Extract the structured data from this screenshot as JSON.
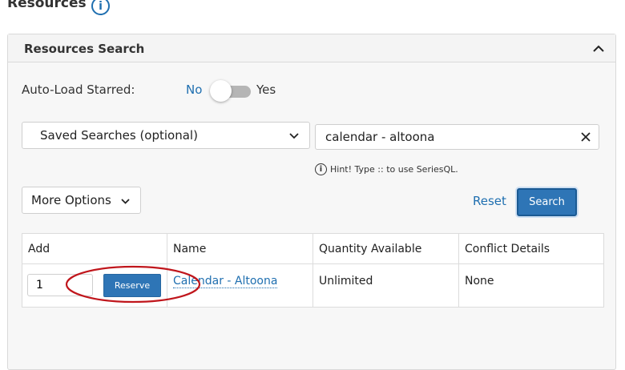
{
  "page": {
    "title": "Resources",
    "info_icon": "info-circle-icon",
    "info_glyph": "i"
  },
  "panel": {
    "title": "Resources Search",
    "collapse_icon": "chevron-up-icon"
  },
  "auto_load": {
    "label": "Auto-Load Starred:",
    "off_label": "No",
    "on_label": "Yes",
    "enabled": false
  },
  "saved_searches": {
    "label": "Saved Searches (optional)",
    "icon": "chevron-down-icon"
  },
  "search": {
    "value": "calendar - altoona",
    "clear_icon": "close-icon"
  },
  "hint": {
    "glyph": "i",
    "text": "Hint! Type :: to use SeriesQL.",
    "icon": "info-circle-icon"
  },
  "more_options": {
    "label": "More Options",
    "icon": "chevron-down-icon"
  },
  "actions": {
    "reset_label": "Reset",
    "search_label": "Search"
  },
  "table": {
    "headers": [
      "Add",
      "Name",
      "Quantity Available",
      "Conflict Details"
    ],
    "rows": [
      {
        "quantity": "1",
        "reserve_label": "Reserve",
        "name": "Calendar - Altoona",
        "available": "Unlimited",
        "conflicts": "None"
      }
    ]
  },
  "colors": {
    "accent": "#2e75b6",
    "link": "#1f6fb0",
    "annotation": "#c0161c"
  }
}
